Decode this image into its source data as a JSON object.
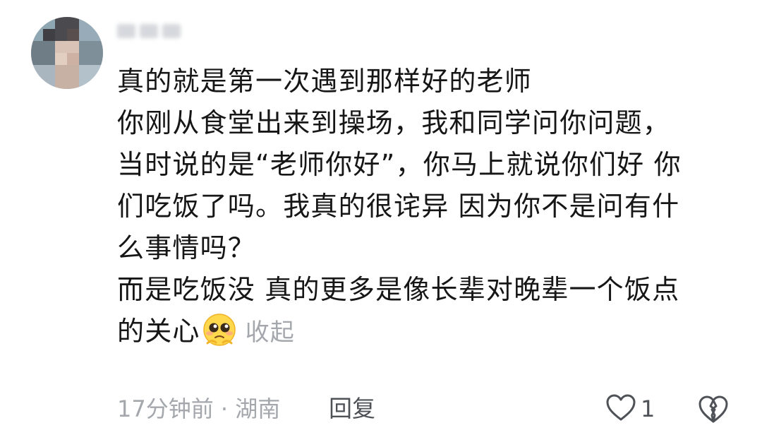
{
  "comment": {
    "lines": [
      "真的就是第一次遇到那样好的老师",
      "你刚从食堂出来到操场，我和同学问你问题，",
      "当时说的是“老师你好”，你马上就说你们好 你",
      "们吃饭了吗。我真的很诧异 因为你不是问有什",
      "么事情吗？",
      "而是吃饭没 真的更多是像长辈对晚辈一个饭点",
      "的关心"
    ],
    "emoji": "pleading-face-emoji",
    "collapse_label": "收起",
    "timestamp": "17分钟前",
    "separator": "·",
    "location": "湖南",
    "reply_label": "回复",
    "like_count": "1"
  },
  "icons": {
    "like": "heart-outline-icon",
    "dislike": "broken-heart-outline-icon"
  },
  "colors": {
    "text": "#161616",
    "secondary": "#a4a7ac",
    "action": "#4e5257"
  }
}
